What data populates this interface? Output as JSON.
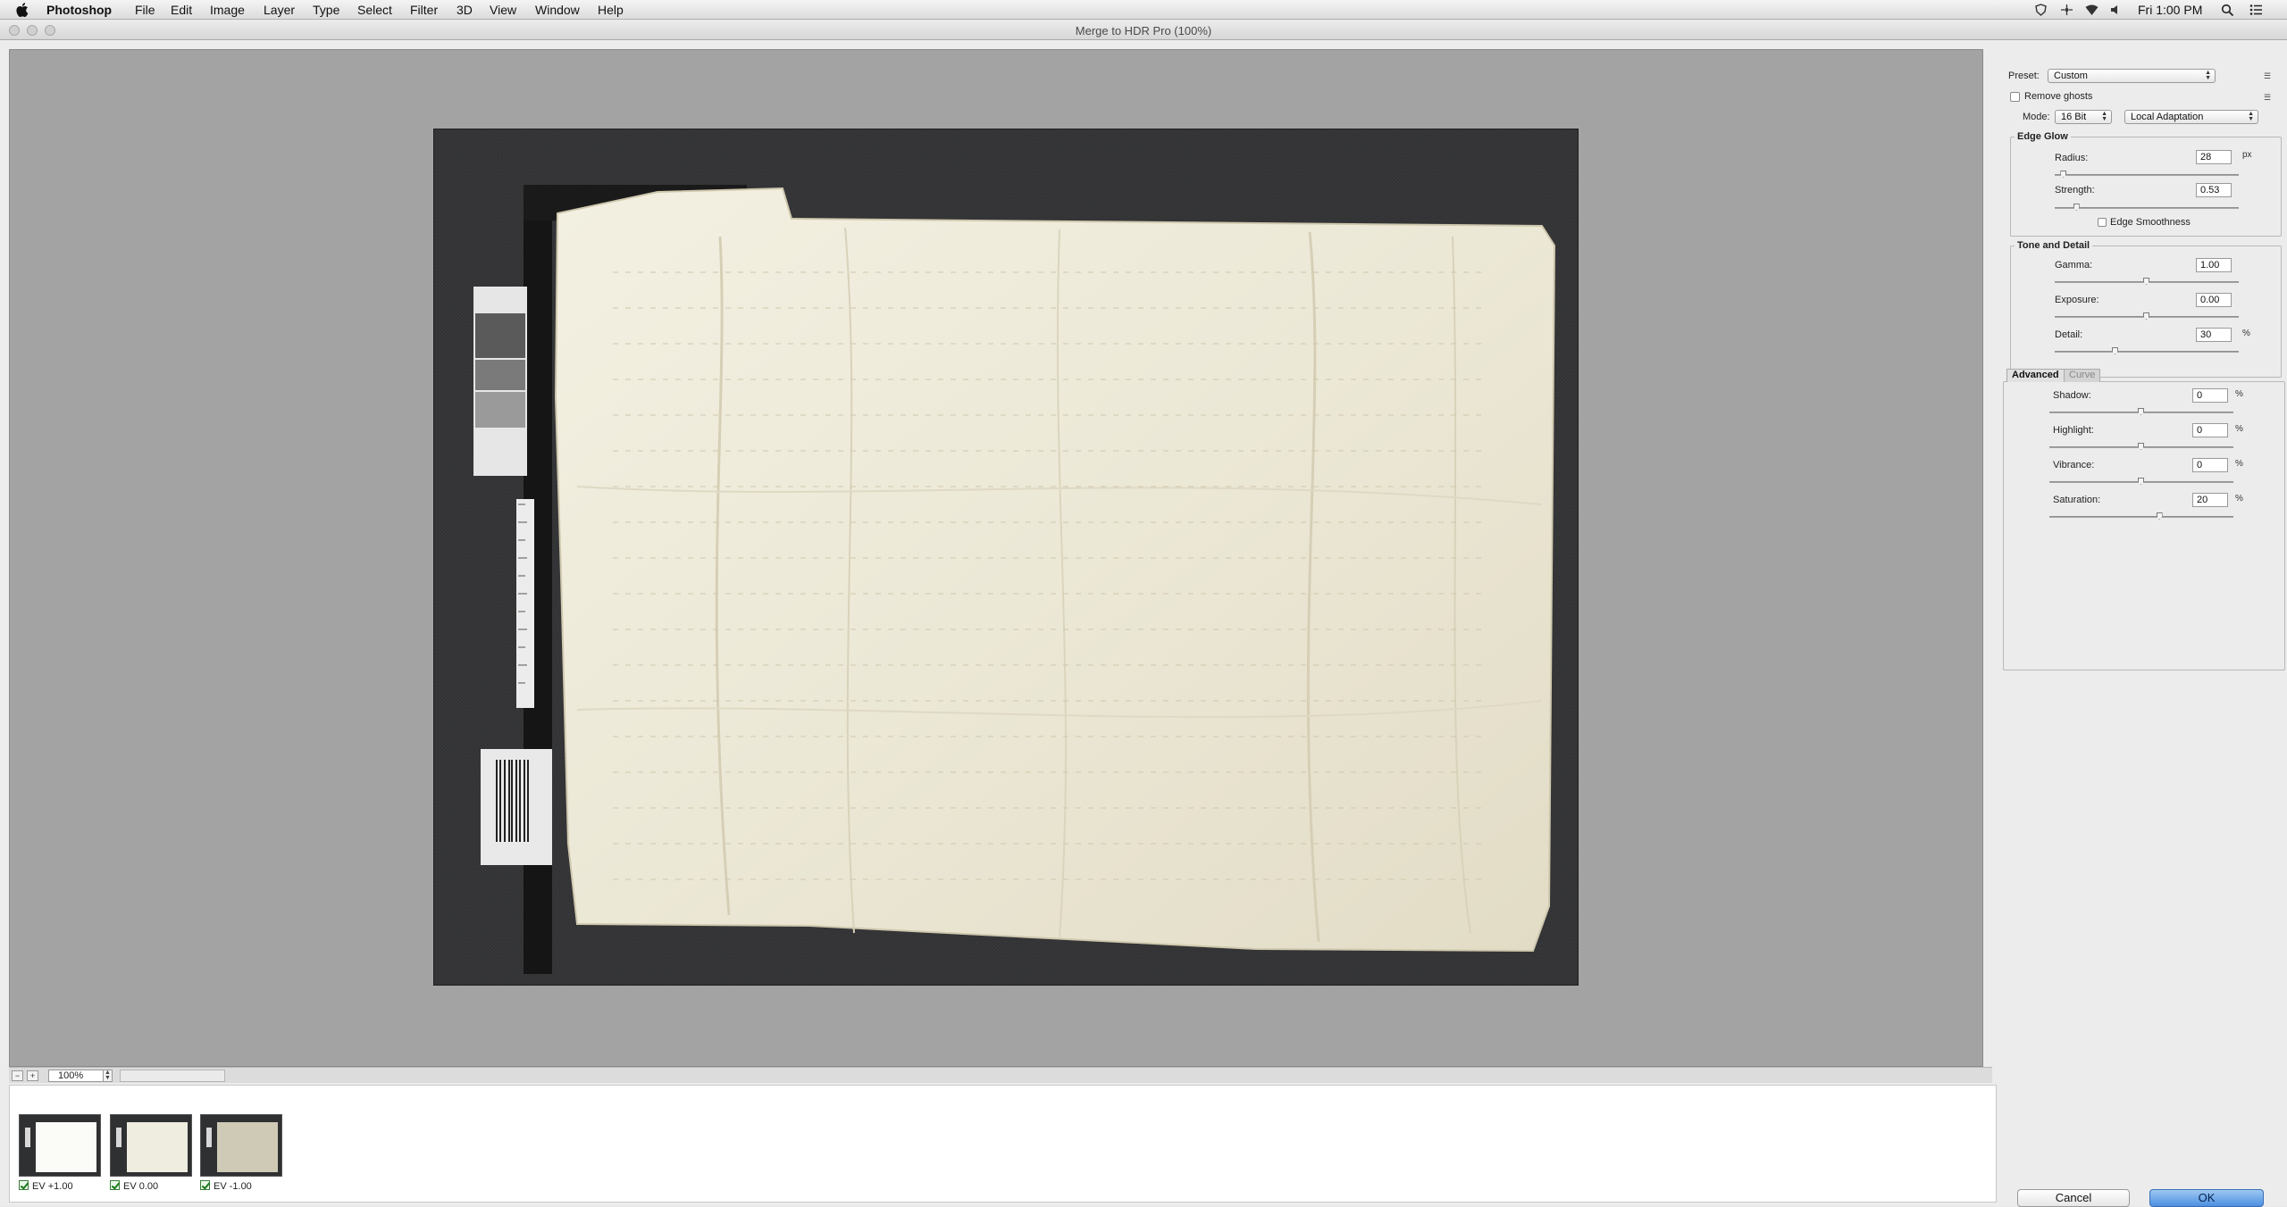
{
  "menubar": {
    "app_name": "Photoshop",
    "items": [
      "File",
      "Edit",
      "Image",
      "Layer",
      "Type",
      "Select",
      "Filter",
      "3D",
      "View",
      "Window",
      "Help"
    ],
    "clock": "Fri 1:00 PM"
  },
  "window": {
    "title": "Merge to HDR Pro (100%)"
  },
  "zoom": {
    "value": "100%"
  },
  "thumbnails": [
    {
      "label": "EV +1.00",
      "checked": true
    },
    {
      "label": "EV 0.00",
      "checked": true
    },
    {
      "label": "EV -1.00",
      "checked": true
    }
  ],
  "panel": {
    "preset_label": "Preset:",
    "preset_value": "Custom",
    "remove_ghosts": "Remove ghosts",
    "mode_label": "Mode:",
    "bit_depth": "16 Bit",
    "method": "Local Adaptation",
    "edge_glow": {
      "title": "Edge Glow",
      "radius_label": "Radius:",
      "radius_value": "28",
      "radius_unit": "px",
      "radius_level": 0.05,
      "strength_label": "Strength:",
      "strength_value": "0.53",
      "strength_level": 0.12,
      "edge_smoothness": "Edge Smoothness"
    },
    "tone_detail": {
      "title": "Tone and Detail",
      "gamma_label": "Gamma:",
      "gamma_value": "1.00",
      "gamma_level": 0.5,
      "exposure_label": "Exposure:",
      "exposure_value": "0.00",
      "exposure_level": 0.5,
      "detail_label": "Detail:",
      "detail_value": "30",
      "detail_unit": "%",
      "detail_level": 0.33
    },
    "tabs": {
      "advanced": "Advanced",
      "curve": "Curve"
    },
    "advanced": {
      "shadow_label": "Shadow:",
      "shadow_value": "0",
      "shadow_level": 0.5,
      "highlight_label": "Highlight:",
      "highlight_value": "0",
      "highlight_level": 0.5,
      "vibrance_label": "Vibrance:",
      "vibrance_value": "0",
      "vibrance_level": 0.5,
      "saturation_label": "Saturation:",
      "saturation_value": "20",
      "saturation_level": 0.6,
      "unit": "%"
    },
    "cancel": "Cancel",
    "ok": "OK"
  }
}
